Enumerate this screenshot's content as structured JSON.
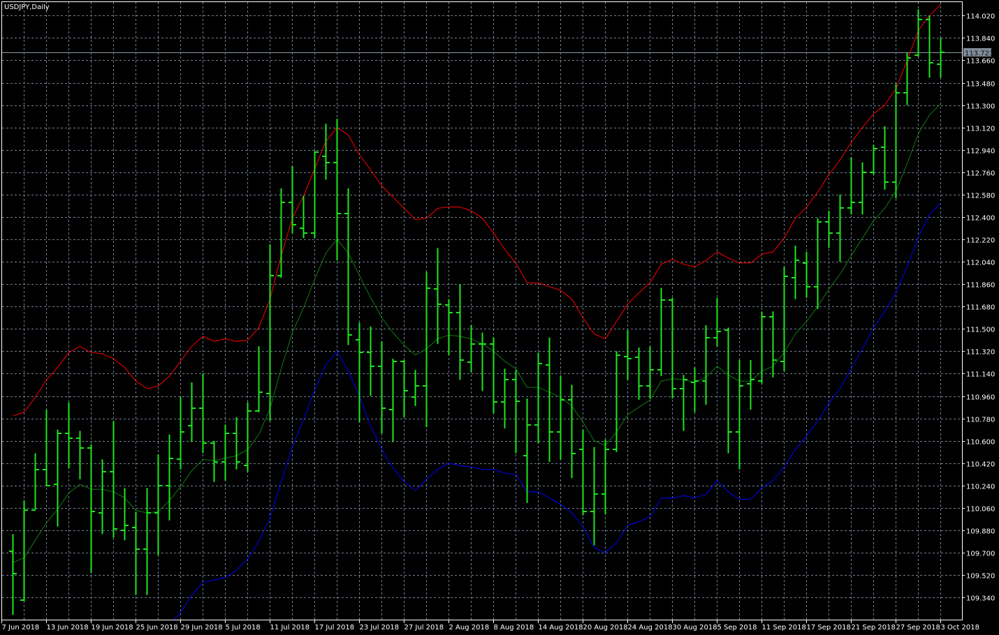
{
  "chart_data": {
    "type": "ohlc",
    "title": "USDJPY,Daily",
    "ylim": [
      109.156,
      114.134
    ],
    "y_ticks": [
      "114.020",
      "113.840",
      "113.660",
      "113.480",
      "113.300",
      "113.120",
      "112.940",
      "112.760",
      "112.580",
      "112.400",
      "112.220",
      "112.040",
      "111.860",
      "111.680",
      "111.500",
      "111.320",
      "111.140",
      "110.960",
      "110.780",
      "110.600",
      "110.420",
      "110.240",
      "110.060",
      "109.880",
      "109.700",
      "109.520",
      "109.340"
    ],
    "x_ticks": [
      {
        "bar": -1,
        "label": "7 Jun 2018"
      },
      {
        "bar": 3,
        "label": "13 Jun 2018"
      },
      {
        "bar": 7,
        "label": "19 Jun 2018"
      },
      {
        "bar": 11,
        "label": "25 Jun 2018"
      },
      {
        "bar": 15,
        "label": "29 Jun 2018"
      },
      {
        "bar": 19,
        "label": "5 Jul 2018"
      },
      {
        "bar": 23,
        "label": "11 Jul 2018"
      },
      {
        "bar": 27,
        "label": "17 Jul 2018"
      },
      {
        "bar": 31,
        "label": "23 Jul 2018"
      },
      {
        "bar": 35,
        "label": "27 Jul 2018"
      },
      {
        "bar": 39,
        "label": "2 Aug 2018"
      },
      {
        "bar": 43,
        "label": "8 Aug 2018"
      },
      {
        "bar": 47,
        "label": "14 Aug 2018"
      },
      {
        "bar": 51,
        "label": "20 Aug 2018"
      },
      {
        "bar": 55,
        "label": "24 Aug 2018"
      },
      {
        "bar": 59,
        "label": "30 Aug 2018"
      },
      {
        "bar": 63,
        "label": "5 Sep 2018"
      },
      {
        "bar": 67,
        "label": "11 Sep 2018"
      },
      {
        "bar": 71,
        "label": "17 Sep 2018"
      },
      {
        "bar": 75,
        "label": "21 Sep 2018"
      },
      {
        "bar": 79,
        "label": "27 Sep 2018"
      },
      {
        "bar": 83,
        "label": "3 Oct 2018"
      }
    ],
    "current_price": 113.723,
    "current_price_label": "113.723",
    "open": [
      109.71,
      109.32,
      110.04,
      110.37,
      110.25,
      110.66,
      110.62,
      110.54,
      110.02,
      110.35,
      109.88,
      109.9,
      109.73,
      110.02,
      110.24,
      110.45,
      110.72,
      110.86,
      110.58,
      110.43,
      110.66,
      110.4,
      110.84,
      110.98,
      111.93,
      112.52,
      112.31,
      112.27,
      112.89,
      112.84,
      112.43,
      111.41,
      111.31,
      111.2,
      110.85,
      111.24,
      110.95,
      111.04,
      111.82,
      111.69,
      111.63,
      111.23,
      111.38,
      111.38,
      110.91,
      111.09,
      110.48,
      110.73,
      111.21,
      110.67,
      110.93,
      110.53,
      110.03,
      110.17,
      110.53,
      111.28,
      111.27,
      111.04,
      111.17,
      111.73,
      111.02,
      111.07,
      111.08,
      111.43,
      111.49,
      110.67,
      111.06,
      111.08,
      111.6,
      111.24,
      111.91,
      112.03,
      111.84,
      112.36,
      112.27,
      112.47,
      112.52,
      112.76,
      112.96,
      112.68,
      113.4,
      113.7,
      113.99,
      113.63
    ],
    "high": [
      109.85,
      110.12,
      110.5,
      110.85,
      110.69,
      110.91,
      110.68,
      110.57,
      110.45,
      110.76,
      110.22,
      110.03,
      110.22,
      110.49,
      110.65,
      110.95,
      111.07,
      111.14,
      110.6,
      110.73,
      110.79,
      110.91,
      111.36,
      112.18,
      112.63,
      112.81,
      112.57,
      112.93,
      113.15,
      113.19,
      112.63,
      111.55,
      111.52,
      111.4,
      111.26,
      111.25,
      111.17,
      111.96,
      112.15,
      111.74,
      111.86,
      111.53,
      111.47,
      111.43,
      111.18,
      111.17,
      110.94,
      111.31,
      111.43,
      111.12,
      111.05,
      110.69,
      110.55,
      110.61,
      111.32,
      111.49,
      111.35,
      111.36,
      111.83,
      111.75,
      111.13,
      111.19,
      111.53,
      111.75,
      111.51,
      111.25,
      111.25,
      111.64,
      111.64,
      112.0,
      112.17,
      112.12,
      112.39,
      112.45,
      112.58,
      112.88,
      112.84,
      112.98,
      113.13,
      113.47,
      113.72,
      114.07,
      114.02,
      113.84
    ],
    "low": [
      109.2,
      109.31,
      110.04,
      110.24,
      109.91,
      110.38,
      110.29,
      109.54,
      109.85,
      109.82,
      109.8,
      109.36,
      109.36,
      109.68,
      109.96,
      110.37,
      110.59,
      110.5,
      110.27,
      110.28,
      110.37,
      110.35,
      110.83,
      110.76,
      111.91,
      112.27,
      112.23,
      112.23,
      112.7,
      112.05,
      111.37,
      110.75,
      110.96,
      110.66,
      110.59,
      110.79,
      110.88,
      110.71,
      111.38,
      111.29,
      111.09,
      111.15,
      111.0,
      110.82,
      110.7,
      110.5,
      110.1,
      110.58,
      110.43,
      110.45,
      110.3,
      110.0,
      109.76,
      110.01,
      110.51,
      111.09,
      110.93,
      110.94,
      111.12,
      110.94,
      110.68,
      110.83,
      110.89,
      111.36,
      110.5,
      110.37,
      110.85,
      111.06,
      111.11,
      111.16,
      111.74,
      111.75,
      111.66,
      112.15,
      112.04,
      112.42,
      112.42,
      112.74,
      112.62,
      112.55,
      113.3,
      113.69,
      113.52,
      113.52
    ],
    "close": [
      109.53,
      110.04,
      110.37,
      110.24,
      110.66,
      110.62,
      110.54,
      110.03,
      110.35,
      109.89,
      109.92,
      109.73,
      110.02,
      110.24,
      110.46,
      110.67,
      110.86,
      110.58,
      110.43,
      110.66,
      110.43,
      110.84,
      110.99,
      111.93,
      112.52,
      112.34,
      112.27,
      112.92,
      112.84,
      112.43,
      111.45,
      111.31,
      111.2,
      110.86,
      111.24,
      111.0,
      111.04,
      111.83,
      111.7,
      111.63,
      111.25,
      111.38,
      111.38,
      110.91,
      111.09,
      110.92,
      110.73,
      111.22,
      110.67,
      110.93,
      110.5,
      110.03,
      110.17,
      110.53,
      111.29,
      111.26,
      111.04,
      111.17,
      111.73,
      111.02,
      111.09,
      111.08,
      111.43,
      111.48,
      110.67,
      111.04,
      111.09,
      111.6,
      111.25,
      111.92,
      112.05,
      111.84,
      112.36,
      112.27,
      112.47,
      112.52,
      112.76,
      112.95,
      112.68,
      113.4,
      113.68,
      113.99,
      113.64,
      113.723
    ],
    "bands": {
      "upper": [
        110.8,
        110.83,
        110.95,
        111.09,
        111.19,
        111.31,
        111.36,
        111.31,
        111.3,
        111.26,
        111.19,
        111.08,
        111.02,
        111.04,
        111.12,
        111.24,
        111.36,
        111.44,
        111.4,
        111.42,
        111.4,
        111.41,
        111.51,
        111.74,
        112.09,
        112.39,
        112.57,
        112.79,
        113.01,
        113.12,
        113.06,
        112.9,
        112.78,
        112.65,
        112.56,
        112.47,
        112.38,
        112.39,
        112.47,
        112.48,
        112.48,
        112.45,
        112.39,
        112.27,
        112.14,
        112.03,
        111.87,
        111.87,
        111.84,
        111.81,
        111.74,
        111.59,
        111.46,
        111.42,
        111.56,
        111.7,
        111.79,
        111.87,
        112.02,
        112.06,
        112.02,
        112.0,
        112.05,
        112.12,
        112.07,
        112.03,
        112.03,
        112.1,
        112.12,
        112.23,
        112.39,
        112.48,
        112.6,
        112.74,
        112.86,
        113.0,
        113.12,
        113.23,
        113.3,
        113.43,
        113.66,
        113.9,
        114.02,
        114.11
      ],
      "middle": [
        109.62,
        109.66,
        109.8,
        109.94,
        110.05,
        110.18,
        110.25,
        110.21,
        110.21,
        110.19,
        110.14,
        110.04,
        110.02,
        110.03,
        110.12,
        110.23,
        110.36,
        110.45,
        110.44,
        110.46,
        110.48,
        110.53,
        110.65,
        110.86,
        111.18,
        111.47,
        111.67,
        111.9,
        112.11,
        112.22,
        112.11,
        111.93,
        111.75,
        111.59,
        111.47,
        111.37,
        111.29,
        111.34,
        111.42,
        111.45,
        111.44,
        111.42,
        111.38,
        111.32,
        111.24,
        111.18,
        111.03,
        111.03,
        110.99,
        110.95,
        110.88,
        110.75,
        110.6,
        110.56,
        110.67,
        110.81,
        110.87,
        110.93,
        111.08,
        111.1,
        111.09,
        111.07,
        111.11,
        111.2,
        111.13,
        111.08,
        111.08,
        111.16,
        111.2,
        111.31,
        111.46,
        111.56,
        111.68,
        111.82,
        111.94,
        112.09,
        112.23,
        112.37,
        112.47,
        112.61,
        112.83,
        113.07,
        113.22,
        113.31
      ],
      "lower": [
        108.44,
        108.49,
        108.65,
        108.79,
        108.91,
        109.05,
        109.14,
        109.11,
        109.12,
        109.12,
        109.09,
        109.0,
        109.02,
        109.02,
        109.12,
        109.22,
        109.36,
        109.46,
        109.48,
        109.5,
        109.56,
        109.65,
        109.79,
        109.98,
        110.27,
        110.55,
        110.77,
        111.01,
        111.21,
        111.32,
        111.16,
        110.96,
        110.72,
        110.53,
        110.38,
        110.27,
        110.2,
        110.29,
        110.37,
        110.42,
        110.4,
        110.39,
        110.37,
        110.37,
        110.34,
        110.33,
        110.19,
        110.19,
        110.14,
        110.09,
        110.02,
        109.91,
        109.74,
        109.7,
        109.78,
        109.92,
        109.95,
        109.99,
        110.14,
        110.14,
        110.16,
        110.14,
        110.17,
        110.28,
        110.19,
        110.13,
        110.13,
        110.22,
        110.28,
        110.39,
        110.53,
        110.64,
        110.76,
        110.9,
        111.02,
        111.18,
        111.34,
        111.51,
        111.64,
        111.79,
        112.0,
        112.24,
        112.42,
        112.51
      ]
    },
    "colors": {
      "bars": "#1ee61e",
      "upper_band": "#ff0000",
      "middle_band": "#127a12",
      "lower_band": "#0000ff",
      "grid": "#6f7f90",
      "current_price_line": "#8d98a4",
      "current_price_tag": "#7f8c99"
    },
    "grid": true
  }
}
